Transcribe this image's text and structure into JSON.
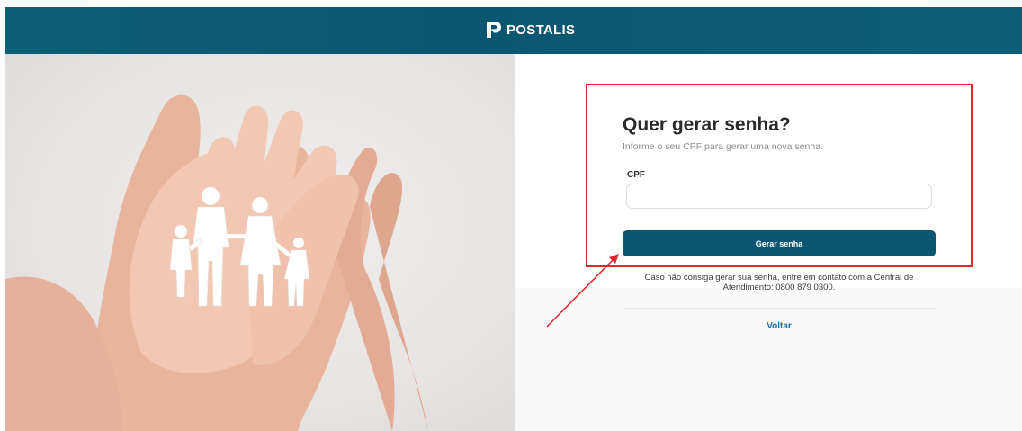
{
  "header": {
    "brand": "POSTALIS"
  },
  "hero": {
    "icon": "hands-family-illustration"
  },
  "form": {
    "title": "Quer gerar senha?",
    "subtitle": "Informe o seu CPF para gerar uma nova senha.",
    "cpf_label": "CPF",
    "cpf_value": "",
    "cpf_placeholder": "",
    "submit_label": "Gerar senha",
    "help_line1": "Caso não consiga gerar sua senha, entre em contato com a Central de",
    "help_line2": "Atendimento: 0800 879 0300.",
    "back_label": "Voltar"
  },
  "colors": {
    "header": "#0b5670",
    "button": "#0b5670",
    "link": "#1b6fa8",
    "annotation": "#e0272e"
  }
}
